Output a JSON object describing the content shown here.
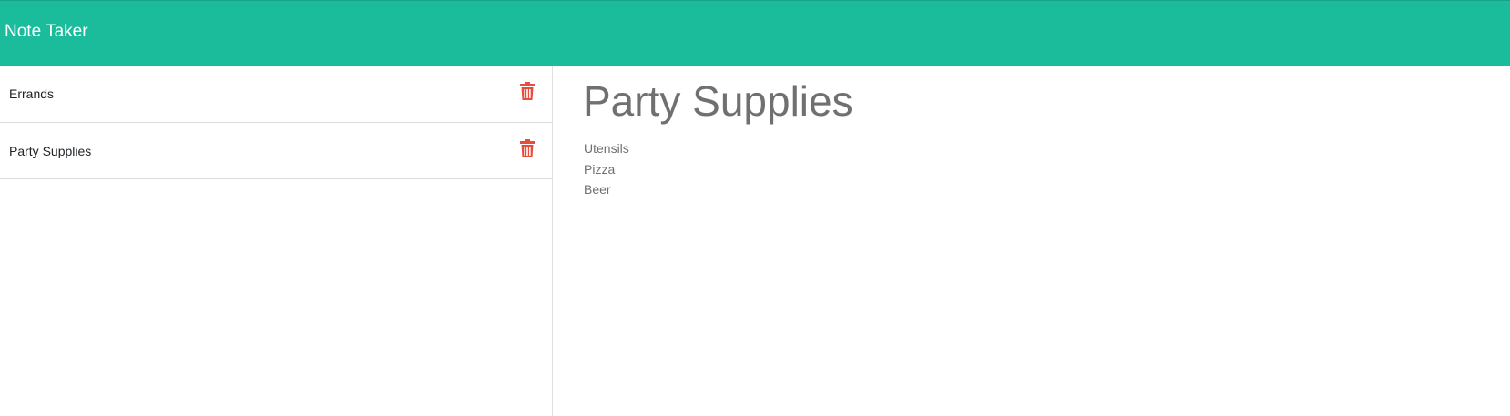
{
  "app": {
    "title": "Note Taker",
    "accent_color": "#1abc9c",
    "delete_color": "#e74c3c"
  },
  "notes": [
    {
      "title": "Errands",
      "delete_icon": "trash-icon"
    },
    {
      "title": "Party Supplies",
      "delete_icon": "trash-icon"
    }
  ],
  "active_note": {
    "title": "Party Supplies",
    "body_lines": [
      "Utensils",
      "Pizza",
      "Beer"
    ]
  }
}
